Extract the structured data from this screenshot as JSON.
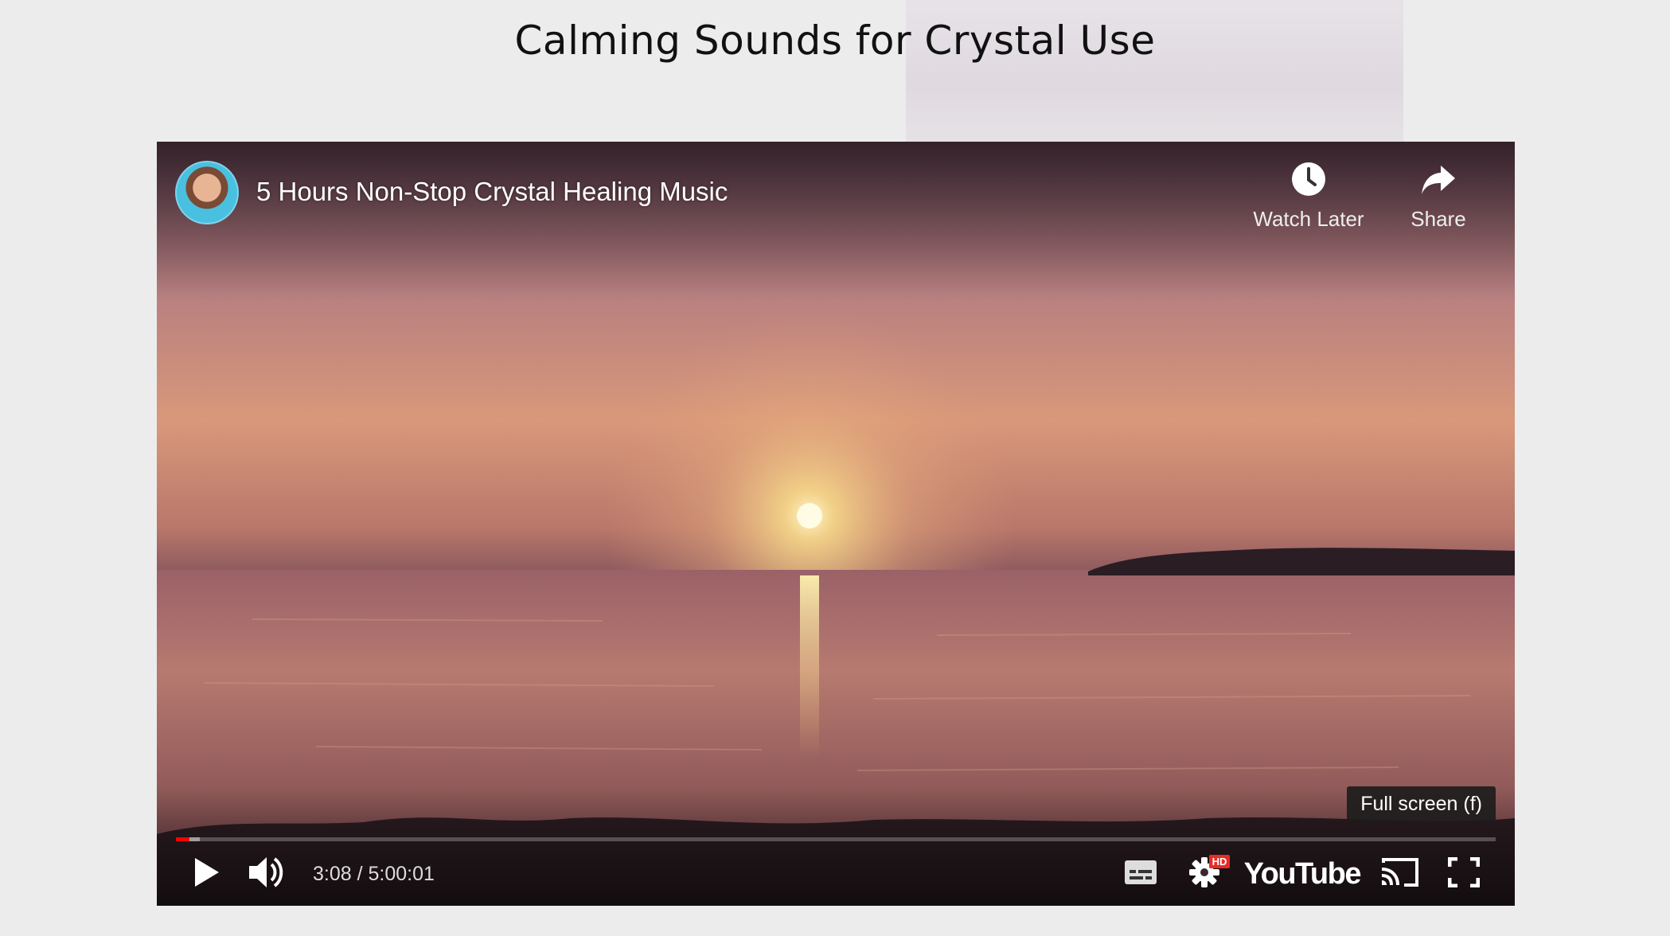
{
  "page": {
    "title": "Calming Sounds for Crystal Use"
  },
  "video": {
    "title": "5 Hours Non-Stop Crystal Healing Music",
    "channel_avatar_icon": "channel-avatar",
    "top_actions": [
      {
        "label": "Watch Later",
        "icon": "clock-icon"
      },
      {
        "label": "Share",
        "icon": "share-arrow-icon"
      }
    ],
    "tooltip": "Full screen (f)",
    "time_display": "3:08 / 5:00:01",
    "progress_played_fraction": 0.0104,
    "progress_buffered_fraction": 0.018,
    "logo_text": "YouTube",
    "hd_badge": "HD",
    "controls": {
      "play_icon": "play-icon",
      "volume_icon": "volume-icon",
      "captions_icon": "captions-icon",
      "settings_icon": "gear-icon",
      "cast_icon": "cast-icon",
      "fullscreen_icon": "fullscreen-icon"
    }
  },
  "colors": {
    "progress_played": "#ff0000",
    "hd_badge": "#e52d27"
  }
}
